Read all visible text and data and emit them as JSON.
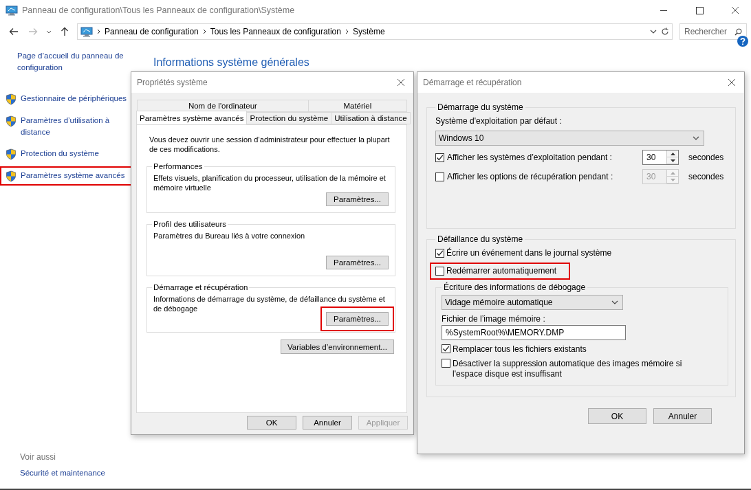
{
  "window": {
    "title": "Panneau de configuration\\Tous les Panneaux de configuration\\Système",
    "address": [
      "Panneau de configuration",
      "Tous les Panneaux de configuration",
      "Système"
    ],
    "search_placeholder": "Rechercher"
  },
  "sidebar": {
    "items": [
      {
        "label": "Page d’accueil du panneau de configuration",
        "kind": "plain",
        "highlighted": false
      },
      {
        "label": "Gestionnaire de périphériques",
        "kind": "shield",
        "highlighted": false
      },
      {
        "label": "Paramètres d’utilisation à distance",
        "kind": "shield",
        "highlighted": false
      },
      {
        "label": "Protection du système",
        "kind": "shield",
        "highlighted": false
      },
      {
        "label": "Paramètres système avancés",
        "kind": "shield",
        "highlighted": true
      }
    ],
    "see_also": {
      "heading": "Voir aussi",
      "links": [
        "Sécurité et maintenance"
      ]
    }
  },
  "main": {
    "heading": "Informations système générales"
  },
  "system_properties": {
    "title": "Propriétés système",
    "tab_rows": [
      [
        {
          "label": "Nom de l'ordinateur",
          "selected": false
        },
        {
          "label": "Matériel",
          "selected": false
        }
      ],
      [
        {
          "label": "Paramètres système avancés",
          "selected": true
        },
        {
          "label": "Protection du système",
          "selected": false
        },
        {
          "label": "Utilisation à distance",
          "selected": false
        }
      ]
    ],
    "notice": "Vous devez ouvrir une session d’administrateur pour effectuer la plupart de ces modifications.",
    "groups": [
      {
        "title": "Performances",
        "description": "Effets visuels, planification du processeur, utilisation de la mémoire et mémoire virtuelle",
        "button": {
          "label": "Paramètres...",
          "highlighted": false
        }
      },
      {
        "title": "Profil des utilisateurs",
        "description": "Paramètres du Bureau liés à votre connexion",
        "button": {
          "label": "Paramètres...",
          "highlighted": false
        }
      },
      {
        "title": "Démarrage et récupération",
        "description": "Informations de démarrage du système, de défaillance du système et de débogage",
        "button": {
          "label": "Paramètres...",
          "highlighted": true
        }
      }
    ],
    "env_button": "Variables d’environnement...",
    "buttons": [
      {
        "label": "OK",
        "disabled": false
      },
      {
        "label": "Annuler",
        "disabled": false
      },
      {
        "label": "Appliquer",
        "disabled": true
      }
    ]
  },
  "startup_recovery": {
    "title": "Démarrage et récupération",
    "startup_group": {
      "title": "Démarrage du système",
      "os_label": "Système d'exploitation par défaut :",
      "os_value": "Windows 10",
      "timers": [
        {
          "label": "Afficher les systèmes d’exploitation pendant :",
          "checked": true,
          "value": "30",
          "unit": "secondes"
        },
        {
          "label": "Afficher les options de récupération pendant :",
          "checked": false,
          "value": "30",
          "unit": "secondes"
        }
      ]
    },
    "failure_group": {
      "title": "Défaillance du système",
      "options": [
        {
          "label": "Écrire un événement dans le journal système",
          "checked": true,
          "highlighted": false
        },
        {
          "label": "Redémarrer automatiquement",
          "checked": false,
          "highlighted": true
        }
      ],
      "debug_group": {
        "title": "Écriture des informations de débogage",
        "dump_type": "Vidage mémoire automatique",
        "file_label": "Fichier de l’image mémoire :",
        "file_value": "%SystemRoot%\\MEMORY.DMP",
        "options": [
          {
            "label": "Remplacer tous les fichiers existants",
            "checked": true
          },
          {
            "label": "Désactiver la suppression automatique des images mémoire si l'espace disque est insuffisant",
            "checked": false
          }
        ]
      }
    },
    "buttons": [
      {
        "label": "OK",
        "disabled": false
      },
      {
        "label": "Annuler",
        "disabled": false
      }
    ]
  }
}
